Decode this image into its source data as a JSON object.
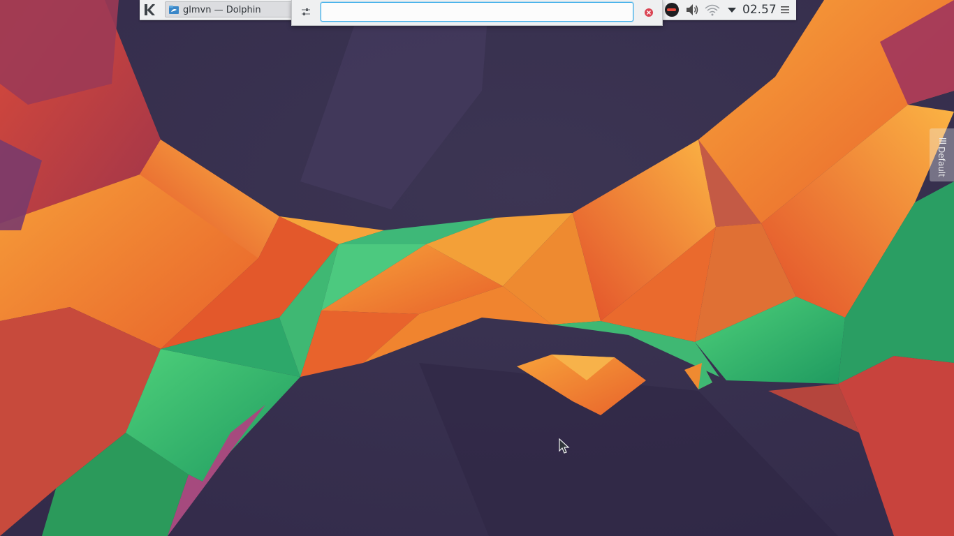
{
  "taskbar": {
    "window_title": "glmvn — Dolphin"
  },
  "krunner": {
    "query": "",
    "placeholder": ""
  },
  "tray": {
    "clock": "02.57"
  },
  "activity": {
    "name": "Default"
  },
  "icons": {
    "launcher": "kde-logo-icon",
    "task": "dolphin-folder-icon",
    "krunner_config": "settings-sliders-icon",
    "krunner_close": "close-icon",
    "tray_app": "tray-app-icon",
    "volume": "speaker-volume-icon",
    "network": "wifi-icon",
    "expand": "expand-arrow-icon",
    "panel_menu": "hamburger-menu-icon",
    "activity": "activity-grip-icon"
  },
  "colors": {
    "panel": "#eff0f1",
    "focus_accent": "#3daee9",
    "close_red": "#da4453"
  }
}
